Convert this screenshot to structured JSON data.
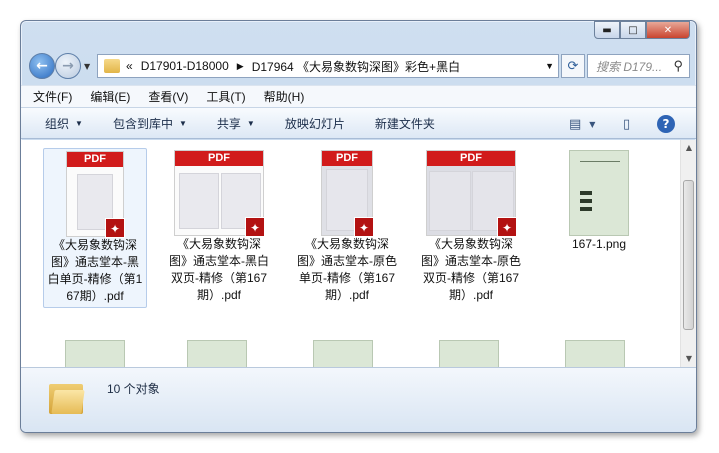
{
  "window": {
    "caption": {
      "min": "▬",
      "max": "□",
      "close": "✕"
    }
  },
  "nav": {
    "back_icon": "back-arrow-icon",
    "forward_icon": "forward-arrow-icon",
    "address_prefix": "«",
    "breadcrumb": [
      "D17901-D18000",
      "D17964 《大易象数钩深图》彩色+黑白"
    ],
    "search_placeholder": "搜索 D179..."
  },
  "menu": [
    "文件(F)",
    "编辑(E)",
    "查看(V)",
    "工具(T)",
    "帮助(H)"
  ],
  "toolbar": {
    "organize": "组织",
    "include": "包含到库中",
    "share": "共享",
    "slideshow": "放映幻灯片",
    "new_folder": "新建文件夹"
  },
  "files": [
    {
      "name": "《大易象数钩深图》通志堂本-黑白单页-精修（第167期）.pdf",
      "type": "pdf",
      "selected": true
    },
    {
      "name": "《大易象数钩深图》通志堂本-黑白双页-精修（第167期）.pdf",
      "type": "pdf"
    },
    {
      "name": "《大易象数钩深图》通志堂本-原色单页-精修（第167期）.pdf",
      "type": "pdf"
    },
    {
      "name": "《大易象数钩深图》通志堂本-原色双页-精修（第167期）.pdf",
      "type": "pdf"
    },
    {
      "name": "167-1.png",
      "type": "png"
    }
  ],
  "pdf_badge": "PDF",
  "status": {
    "count": "10 个对象"
  }
}
